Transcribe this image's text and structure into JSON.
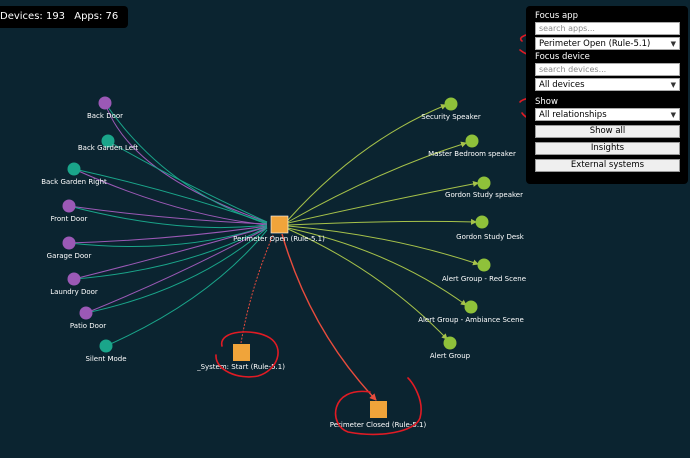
{
  "stats": {
    "devices": "Devices: 193",
    "apps": "Apps: 76"
  },
  "panel": {
    "focus_app_label": "Focus app",
    "search_apps_placeholder": "search apps...",
    "focus_app_selected": "Perimeter Open (Rule-5.1)",
    "focus_device_label": "Focus device",
    "search_devices_placeholder": "search devices...",
    "focus_device_selected": "All devices",
    "show_label": "Show",
    "show_selected": "All relationships",
    "show_all_button": "Show all",
    "insights_button": "Insights",
    "external_systems_button": "External systems"
  },
  "graph": {
    "center_app": "Perimeter Open (Rule-5.1)",
    "trigger_devices": [
      {
        "label": "Back Door",
        "color": "#9b59b6"
      },
      {
        "label": "Back Garden Left",
        "color": "#1aa58a"
      },
      {
        "label": "Back Garden Right",
        "color": "#1aa58a"
      },
      {
        "label": "Front Door",
        "color": "#9b59b6"
      },
      {
        "label": "Garage Door",
        "color": "#9b59b6"
      },
      {
        "label": "Laundry Door",
        "color": "#9b59b6"
      },
      {
        "label": "Patio Door",
        "color": "#9b59b6"
      },
      {
        "label": "Silent Mode",
        "color": "#1aa58a"
      }
    ],
    "target_devices": [
      {
        "label": "Security Speaker"
      },
      {
        "label": "Master Bedroom speaker"
      },
      {
        "label": "Gordon Study speaker"
      },
      {
        "label": "Gordon Study Desk"
      },
      {
        "label": "Alert Group - Red Scene"
      },
      {
        "label": "Alert Group - Ambiance Scene"
      },
      {
        "label": "Alert Group"
      }
    ],
    "other_apps": [
      {
        "label": "_System: Start (Rule-5.1)"
      },
      {
        "label": "Perimeter Closed (Rule-5.1)"
      }
    ]
  },
  "colors": {
    "background": "#0b2430",
    "app_node": "#f0a43a",
    "target_node": "#8fc13a",
    "target_edge": "#a6c24a",
    "purple_edge": "#9b59b6",
    "teal_edge": "#1aa58a",
    "link_edge": "#e84c3d",
    "annotation": "#e01b24"
  }
}
